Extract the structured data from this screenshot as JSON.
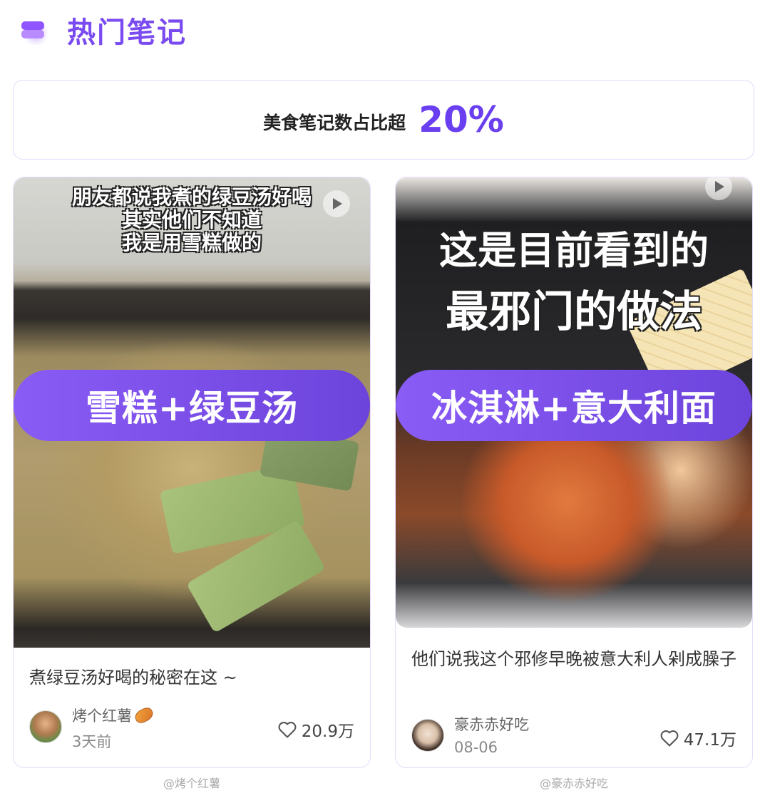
{
  "header": {
    "title": "热门笔记",
    "icon": "layers-icon"
  },
  "stat": {
    "label": "美食笔记数占比超",
    "value": "20%"
  },
  "accent_color": "#7a4bf0",
  "cards": [
    {
      "overlay_text": [
        "朋友都说我煮的绿豆汤好喝",
        "其实他们不知道",
        "我是用雪糕做的"
      ],
      "banner": "雪糕+绿豆汤",
      "title": "煮绿豆汤好喝的秘密在这 ~",
      "author": "烤个红薯",
      "time": "3天前",
      "likes": "20.9万",
      "caption": "@烤个红薯"
    },
    {
      "overlay_text": [
        "这是目前看到的",
        "最邪门的做法"
      ],
      "banner": "冰淇淋+意大利面",
      "title": "他们说我这个邪修早晚被意大利人剁成臊子",
      "author": "豪赤赤好吃",
      "time": "08-06",
      "likes": "47.1万",
      "caption": "@豪赤赤好吃"
    }
  ]
}
